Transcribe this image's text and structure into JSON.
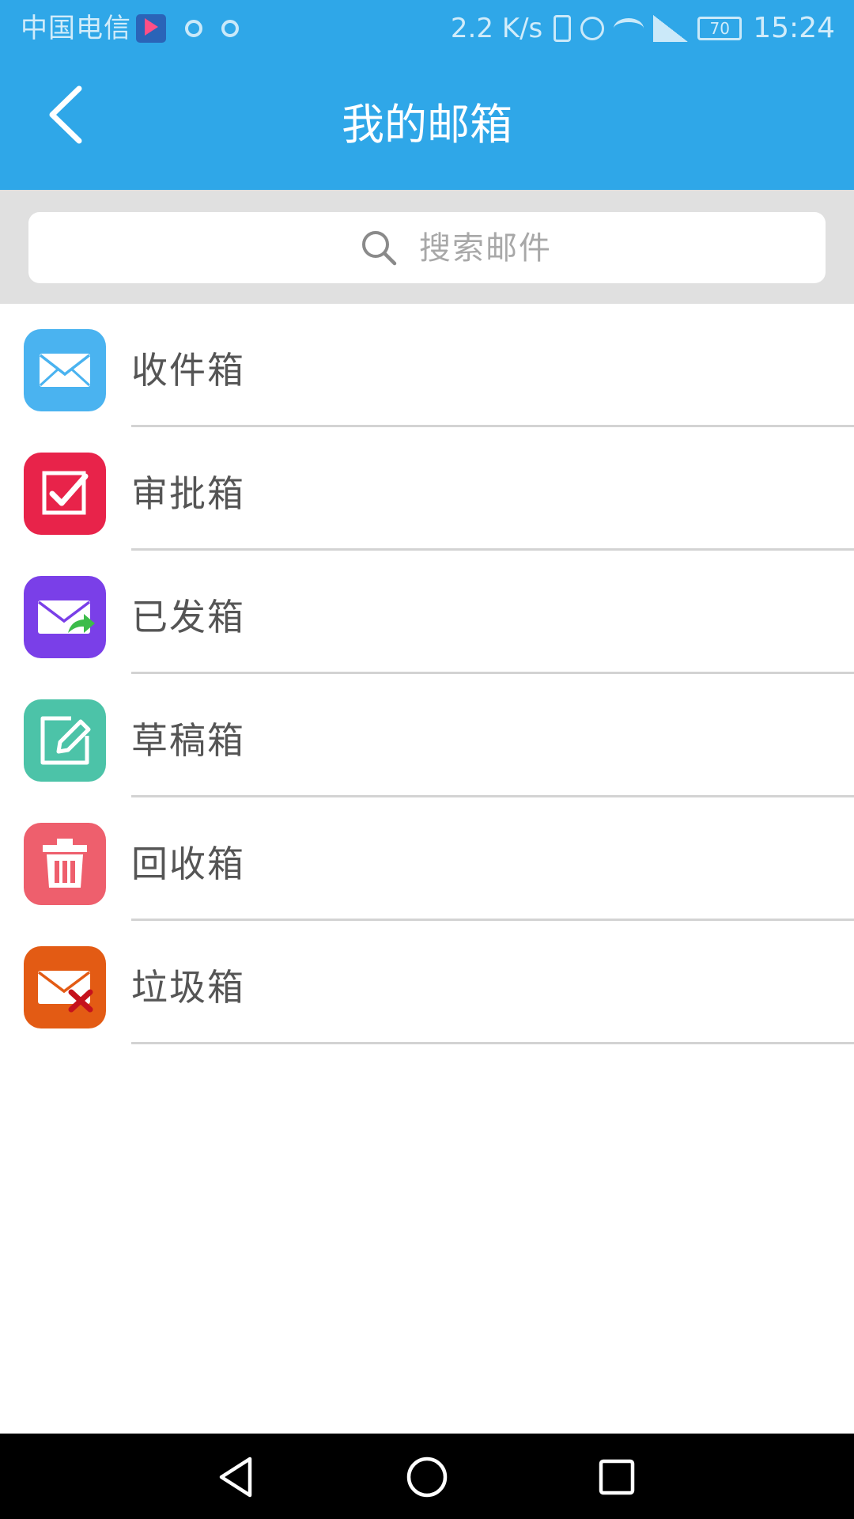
{
  "status_bar": {
    "carrier": "中国电信",
    "net_speed": "2.2 K/s",
    "battery": "70",
    "time": "15:24"
  },
  "header": {
    "title": "我的邮箱",
    "back_icon": "chevron-left-icon"
  },
  "search": {
    "placeholder": "搜索邮件",
    "icon": "search-icon"
  },
  "mailboxes": [
    {
      "label": "收件箱",
      "icon": "envelope-icon",
      "color": "#4ab3f0"
    },
    {
      "label": "审批箱",
      "icon": "checkbox-icon",
      "color": "#e8234a"
    },
    {
      "label": "已发箱",
      "icon": "envelope-sent-icon",
      "color": "#7a3fe8"
    },
    {
      "label": "草稿箱",
      "icon": "edit-icon",
      "color": "#4cc3a8"
    },
    {
      "label": "回收箱",
      "icon": "trash-icon",
      "color": "#ee5f6d"
    },
    {
      "label": "垃圾箱",
      "icon": "envelope-x-icon",
      "color": "#e35b14"
    }
  ],
  "colors": {
    "app_bar": "#2fa7e8",
    "search_background": "#e0e0e0",
    "divider": "#d3d3d3",
    "label_text": "#555555"
  },
  "nav_bar": {
    "back_icon": "triangle-back-icon",
    "home_icon": "circle-home-icon",
    "recents_icon": "square-recents-icon"
  }
}
